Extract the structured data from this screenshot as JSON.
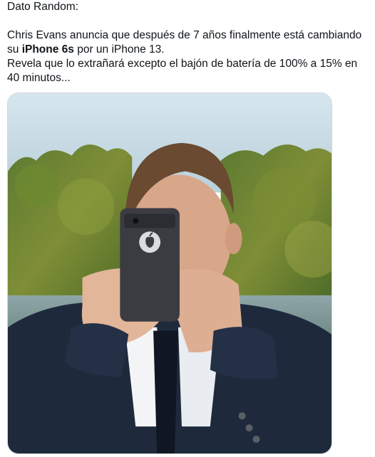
{
  "tweet": {
    "line1": "Dato Random:",
    "line2_prefix": "Chris Evans anuncia que después de 7 años finalmente está cambiando su ",
    "line2_bold": "iPhone 6s",
    "line2_suffix": " por un iPhone 13.",
    "line3": "Revela que lo extrañará excepto el bajón de batería de 100% a 15% en 40 minutos..."
  },
  "media": {
    "icon": "apple-logo-icon",
    "colors": {
      "sky": "#c9dbe6",
      "trees_dark": "#4a6b2a",
      "trees_light": "#8a9a3a",
      "suit": "#1f2a3d",
      "phone": "#3a3a40",
      "skin": "#d9a98c",
      "hair": "#6b4a32"
    }
  }
}
